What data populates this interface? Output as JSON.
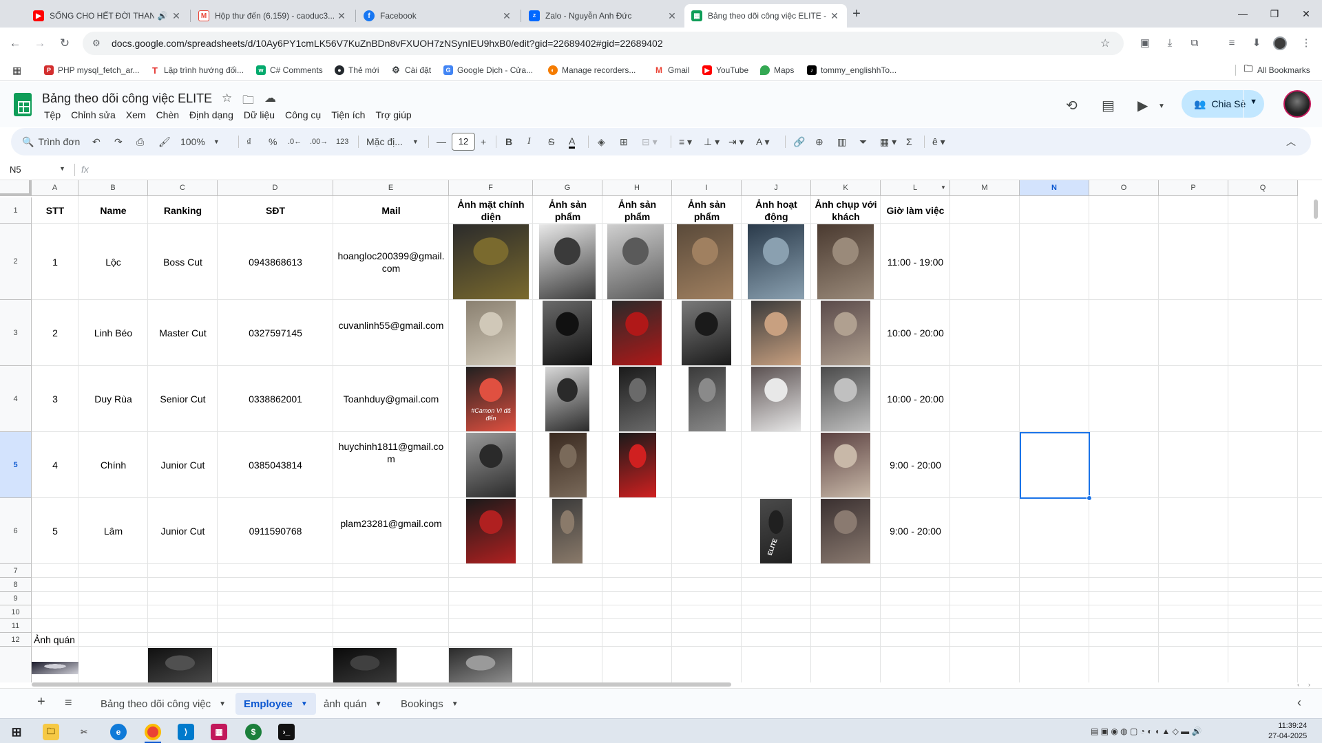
{
  "browser": {
    "tabs": [
      {
        "title": "SỐNG CHO HẾT ĐỜI THAN",
        "icon": "youtube-icon",
        "color": "#ff0000"
      },
      {
        "title": "Hộp thư đến (6.159) - caoduc3...",
        "icon": "gmail-icon",
        "color": "#ea4335"
      },
      {
        "title": "Facebook",
        "icon": "facebook-icon",
        "color": "#1877f2"
      },
      {
        "title": "Zalo - Nguyễn Anh Đức",
        "icon": "zalo-icon",
        "color": "#0068ff"
      },
      {
        "title": "Bảng theo dõi công việc ELITE -",
        "icon": "sheets-icon",
        "color": "#0f9d58"
      }
    ],
    "url": "docs.google.com/spreadsheets/d/10Ay6PY1cmLK56V7KuZnBDn8vFXUOH7zNSynIEU9hxB0/edit?gid=22689402#gid=22689402",
    "bookmarks": [
      {
        "label": "PHP mysql_fetch_ar...",
        "icon": "php-icon",
        "color": "#d32f2f"
      },
      {
        "label": "Lập trình hướng đối...",
        "icon": "t-icon",
        "color": "#e53935"
      },
      {
        "label": "C# Comments",
        "icon": "w3-icon",
        "color": "#04aa6d"
      },
      {
        "label": "Thẻ mới",
        "icon": "github-icon",
        "color": "#24292e"
      },
      {
        "label": "Cài đặt",
        "icon": "gear-icon",
        "color": "#5f6368"
      },
      {
        "label": "Google Dịch - Cửa...",
        "icon": "translate-icon",
        "color": "#4285f4"
      },
      {
        "label": "Manage recorders...",
        "icon": "recorder-icon",
        "color": "#f57c00"
      },
      {
        "label": "Gmail",
        "icon": "gmail-icon",
        "color": "#ea4335"
      },
      {
        "label": "YouTube",
        "icon": "youtube-icon",
        "color": "#ff0000"
      },
      {
        "label": "Maps",
        "icon": "maps-icon",
        "color": "#34a853"
      },
      {
        "label": "tommy_englishhTo...",
        "icon": "tiktok-icon",
        "color": "#000000"
      }
    ],
    "all_bookmarks": "All Bookmarks"
  },
  "sheets": {
    "title": "Bảng theo dõi công việc ELITE",
    "menu": [
      "Tệp",
      "Chỉnh sửa",
      "Xem",
      "Chèn",
      "Định dạng",
      "Dữ liệu",
      "Công cụ",
      "Tiện ích",
      "Trợ giúp"
    ],
    "share_label": "Chia Sẻ",
    "toolbar": {
      "search": "Trình đơn",
      "zoom": "100%",
      "currency": "₫",
      "percent": "%",
      "dec_less": ".0",
      "dec_more": ".00",
      "number_format": "123",
      "font": "Mặc đị...",
      "font_size": "12"
    },
    "name_box": "N5",
    "fx": "fx",
    "columns": [
      "A",
      "B",
      "C",
      "D",
      "E",
      "F",
      "G",
      "H",
      "I",
      "J",
      "K",
      "L",
      "M",
      "N",
      "O",
      "P",
      "Q"
    ],
    "selected_column": "N",
    "rows": [
      "1",
      "2",
      "3",
      "4",
      "5",
      "6",
      "7",
      "8",
      "9",
      "10",
      "11",
      "12"
    ],
    "selected_row": "5",
    "headers": {
      "stt": "STT",
      "name": "Name",
      "ranking": "Ranking",
      "sdt": "SĐT",
      "mail": "Mail",
      "anh_mat": "Ảnh mặt chính diện",
      "anh_sp1": "Ảnh sản phẩm",
      "anh_sp2": "Ảnh sản phẩm",
      "anh_sp3": "Ảnh sản phẩm",
      "anh_hd": "Ảnh hoạt động",
      "anh_khach": "Ảnh chụp với khách",
      "gio": "Giờ làm việc"
    },
    "employees": [
      {
        "stt": "1",
        "name": "Lộc",
        "ranking": "Boss Cut",
        "sdt": "0943868613",
        "mail": "hoangloc200399@gmail.com",
        "gio": "11:00 - 19:00"
      },
      {
        "stt": "2",
        "name": "Linh Béo",
        "ranking": "Master Cut",
        "sdt": "0327597145",
        "mail": "cuvanlinh55@gmail.com",
        "gio": "10:00 - 20:00"
      },
      {
        "stt": "3",
        "name": "Duy Rùa",
        "ranking": "Senior Cut",
        "sdt": "0338862001",
        "mail": "Toanhduy@gmail.com",
        "gio": "10:00 - 20:00"
      },
      {
        "stt": "4",
        "name": "Chính",
        "ranking": "Junior Cut",
        "sdt": "0385043814",
        "mail": "huychinh1811@gmail.com",
        "gio": "9:00 - 20:00"
      },
      {
        "stt": "5",
        "name": "Lâm",
        "ranking": "Junior Cut",
        "sdt": "0911590768",
        "mail": "plam23281@gmail.com",
        "gio": "9:00 - 20:00"
      }
    ],
    "photo_texts": {
      "elite_stamp": "ELITE",
      "camon_caption": "#Camon Vì đã đến"
    },
    "anh_quan_label": "Ảnh quán",
    "sheet_tabs": [
      "Bảng theo dõi công việc",
      "Employee",
      "ảnh quán",
      "Bookings"
    ],
    "active_sheet": "Employee"
  },
  "taskbar": {
    "time": "11:39:24",
    "date": "27-04-2025"
  }
}
